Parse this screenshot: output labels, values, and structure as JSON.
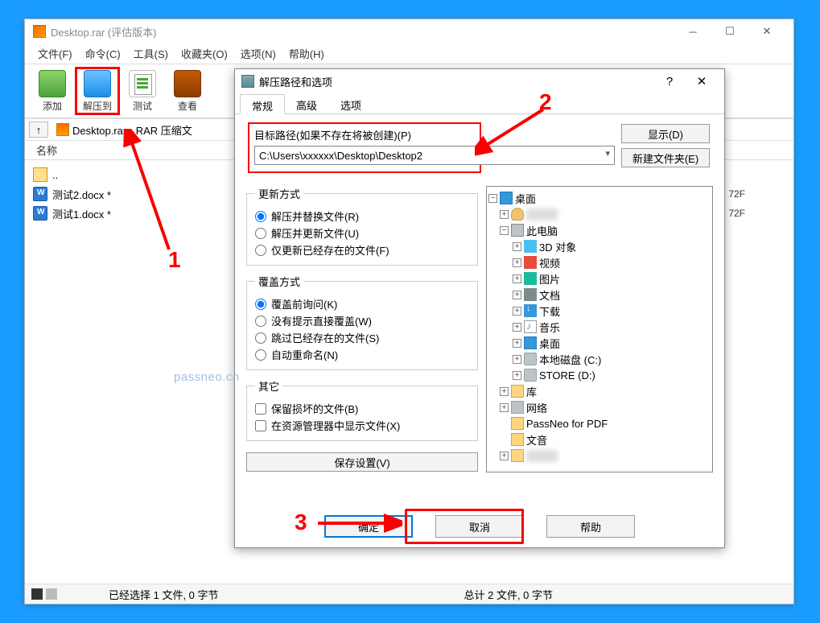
{
  "main_window": {
    "title": "Desktop.rar (评估版本)",
    "menu": [
      "文件(F)",
      "命令(C)",
      "工具(S)",
      "收藏夹(O)",
      "选项(N)",
      "帮助(H)"
    ],
    "toolbar": {
      "add": "添加",
      "extract": "解压到",
      "test": "测试",
      "view": "查看"
    },
    "path_text": "Desktop.rar - RAR 压缩文",
    "header_col": "名称",
    "files": {
      "up": "..",
      "f1": "测试2.docx *",
      "f2": "测试1.docx *"
    },
    "date1": "72F",
    "date2": "72F",
    "status_left": "已经选择 1 文件, 0 字节",
    "status_right": "总计 2 文件, 0 字节"
  },
  "dialog": {
    "title": "解压路径和选项",
    "tabs": {
      "t1": "常规",
      "t2": "高级",
      "t3": "选项"
    },
    "path_label": "目标路径(如果不存在将被创建)(P)",
    "path_value": "C:\\Users\\xxxxxx\\Desktop\\Desktop2",
    "btn_show": "显示(D)",
    "btn_newfolder": "新建文件夹(E)",
    "update_legend": "更新方式",
    "update": {
      "u1": "解压并替换文件(R)",
      "u2": "解压并更新文件(U)",
      "u3": "仅更新已经存在的文件(F)"
    },
    "overwrite_legend": "覆盖方式",
    "overwrite": {
      "o1": "覆盖前询问(K)",
      "o2": "没有提示直接覆盖(W)",
      "o3": "跳过已经存在的文件(S)",
      "o4": "自动重命名(N)"
    },
    "other_legend": "其它",
    "other": {
      "c1": "保留损坏的文件(B)",
      "c2": "在资源管理器中显示文件(X)"
    },
    "save_btn": "保存设置(V)",
    "tree": {
      "desktop": "桌面",
      "user": "xxxxxx",
      "pc": "此电脑",
      "t_3d": "3D 对象",
      "t_video": "视频",
      "t_pic": "图片",
      "t_doc": "文档",
      "t_dl": "下载",
      "t_music": "音乐",
      "t_desk": "桌面",
      "t_c": "本地磁盘 (C:)",
      "t_d": "STORE (D:)",
      "t_lib": "库",
      "t_net": "网络",
      "t_passneo": "PassNeo for PDF",
      "t_wenyin": "文音",
      "t_last": "xxxxxx"
    },
    "footer": {
      "ok": "确定",
      "cancel": "取消",
      "help": "帮助"
    }
  },
  "annotations": {
    "n1": "1",
    "n2": "2",
    "n3": "3"
  },
  "watermark": "passneo.cn"
}
